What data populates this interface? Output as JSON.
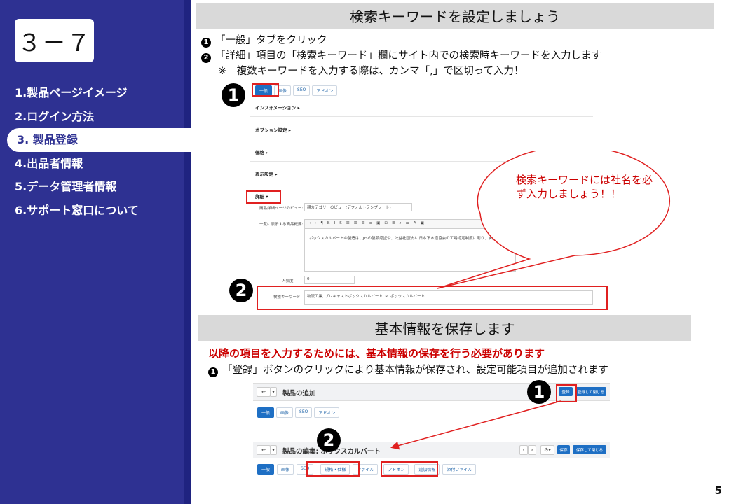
{
  "sidebar": {
    "slide_no": "３－７",
    "items": [
      {
        "label": "1.製品ページイメージ"
      },
      {
        "label": "2.ログイン方法"
      },
      {
        "label": "3. 製品登録"
      },
      {
        "label": "4.出品者情報"
      },
      {
        "label": "5.データ管理者情報"
      },
      {
        "label": "6.サポート窓口について"
      }
    ]
  },
  "section1": {
    "title": "検索キーワードを設定しましょう",
    "step1": "「一般」タブをクリック",
    "step2": "「詳細」項目の「検索キーワード」欄にサイト内での検索時キーワードを入力します",
    "note": "※　複数キーワードを入力する際は、カンマ「,」で区切って入力！",
    "callout": "検索キーワードには社名を必ず入力しましょう！！",
    "screenshot": {
      "tabs": [
        "一般",
        "画像",
        "SEO",
        "アドオン"
      ],
      "sections": [
        "インフォメーション ▸",
        "オプション設定 ▸",
        "価格 ▸",
        "表示設定 ▸",
        "詳細 ▾"
      ],
      "view_label": "商品詳細ページのビュー:",
      "view_value": "親カテゴリーのビュー(デフォルトテンプレート)",
      "summary_label": "一覧に表示する商品概要:",
      "summary_text": "ボックスカルバートの製造は、JISの製品認証や、公益社団法人 日本下水道協会の工場認定制度に則り、す。",
      "popularity_label": "人気度",
      "popularity_value": "0",
      "keyword_label": "検索キーワード:",
      "keyword_value": "物流工業, プレキャストボックスカルバート, RCボックスカルバート"
    }
  },
  "section2": {
    "title": "基本情報を保存します",
    "warning": "以降の項目を入力するためには、基本情報の保存を行う必要があります",
    "step1": "「登録」ボタンのクリックにより基本情報が保存され、設定可能項目が追加されます",
    "screenshot": {
      "add_title": "製品の追加",
      "edit_title": "製品の編集: ボックスカルバート",
      "register_btn": "登録",
      "register_close_btn": "登録して閉じる",
      "save_btn": "保存",
      "save_close_btn": "保存して閉じる",
      "tabs_top": [
        "一般",
        "画像",
        "SEO",
        "アドオン"
      ],
      "tabs_bottom": [
        "一般",
        "画像",
        "SEO",
        "規格・仕様",
        "ファイル",
        "アドオン",
        "追加情報",
        "添付ファイル"
      ]
    }
  },
  "page_number": "5"
}
